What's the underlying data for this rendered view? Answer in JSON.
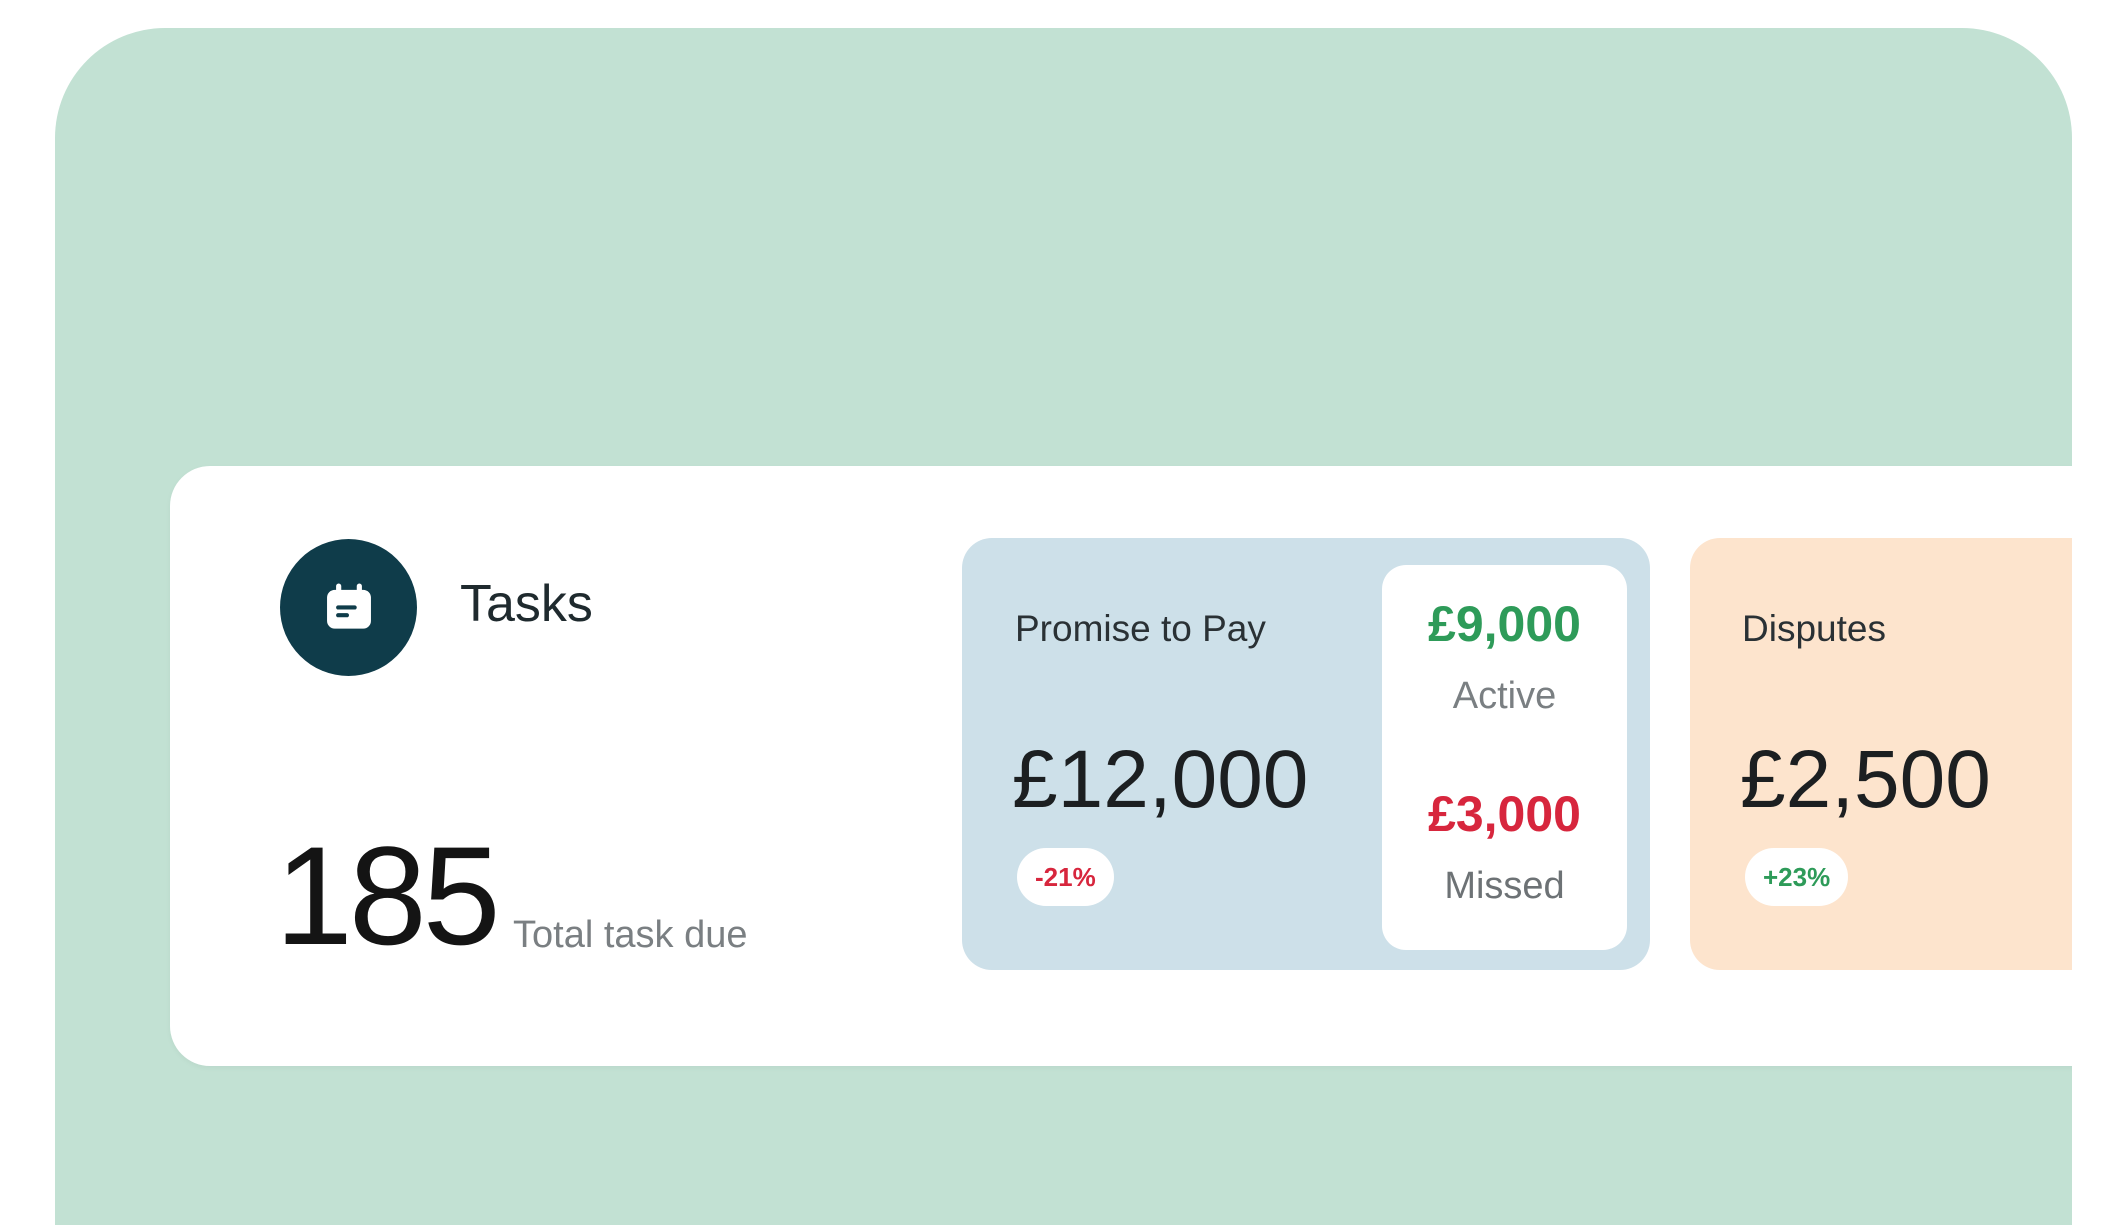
{
  "tasks": {
    "title": "Tasks",
    "count": "185",
    "subtitle": "Total task due"
  },
  "promise_to_pay": {
    "title": "Promise to Pay",
    "value": "£12,000",
    "change": "-21%",
    "active_value": "£9,000",
    "active_label": "Active",
    "missed_value": "£3,000",
    "missed_label": "Missed"
  },
  "disputes": {
    "title": "Disputes",
    "value": "£2,500",
    "change": "+23%"
  },
  "colors": {
    "background": "#c2e1d3",
    "icon_bg": "#0f3c4a",
    "ptp_card": "#cde0e9",
    "disputes_card": "#fde4cd",
    "positive": "#2e9b59",
    "negative": "#d7263d"
  },
  "icons": {
    "tasks": "calendar-icon"
  }
}
